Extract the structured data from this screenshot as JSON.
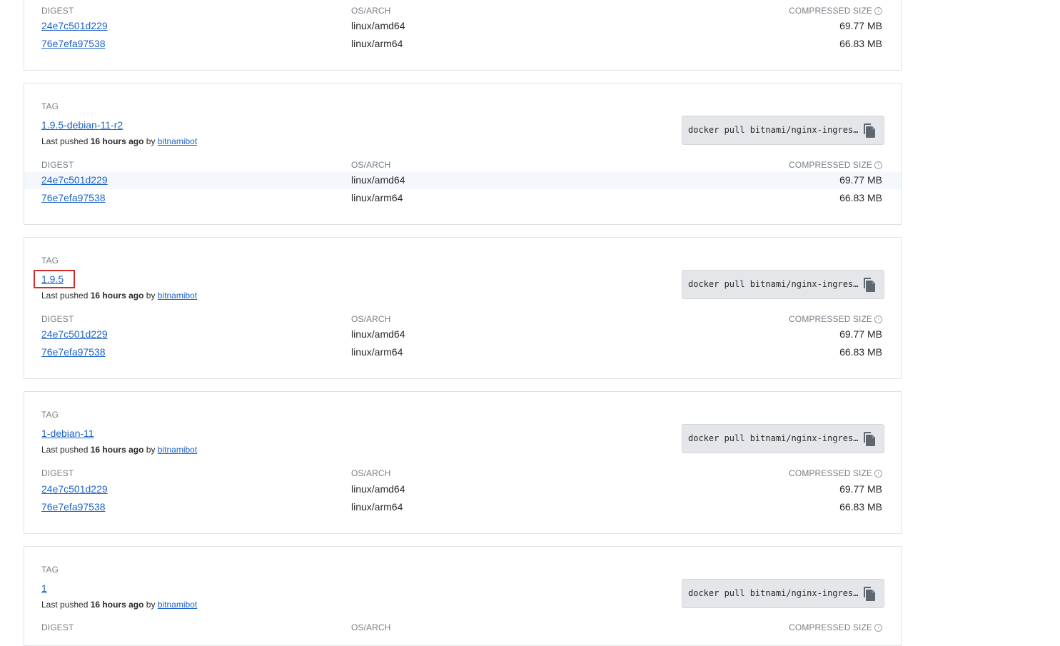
{
  "labels": {
    "tag": "TAG",
    "digest": "DIGEST",
    "os_arch": "OS/ARCH",
    "compressed_size": "COMPRESSED SIZE",
    "last_pushed": "Last pushed",
    "by": "by"
  },
  "pull_command": "docker pull bitnami/nginx-ingres…",
  "cards": [
    {
      "tag": null,
      "pushed_ago": null,
      "pushed_by": null,
      "rows": [
        {
          "digest": "24e7c501d229",
          "os_arch": "linux/amd64",
          "size": "69.77 MB"
        },
        {
          "digest": "76e7efa97538",
          "os_arch": "linux/arm64",
          "size": "66.83 MB"
        }
      ]
    },
    {
      "tag": "1.9.5-debian-11-r2",
      "pushed_ago": "16 hours ago",
      "pushed_by": "bitnamibot",
      "rows": [
        {
          "digest": "24e7c501d229",
          "os_arch": "linux/amd64",
          "size": "69.77 MB",
          "highlighted": true
        },
        {
          "digest": "76e7efa97538",
          "os_arch": "linux/arm64",
          "size": "66.83 MB"
        }
      ]
    },
    {
      "tag": "1.9.5",
      "pushed_ago": "16 hours ago",
      "pushed_by": "bitnamibot",
      "rows": [
        {
          "digest": "24e7c501d229",
          "os_arch": "linux/amd64",
          "size": "69.77 MB"
        },
        {
          "digest": "76e7efa97538",
          "os_arch": "linux/arm64",
          "size": "66.83 MB"
        }
      ]
    },
    {
      "tag": "1-debian-11",
      "pushed_ago": "16 hours ago",
      "pushed_by": "bitnamibot",
      "rows": [
        {
          "digest": "24e7c501d229",
          "os_arch": "linux/amd64",
          "size": "69.77 MB"
        },
        {
          "digest": "76e7efa97538",
          "os_arch": "linux/arm64",
          "size": "66.83 MB"
        }
      ]
    },
    {
      "tag": "1",
      "pushed_ago": "16 hours ago",
      "pushed_by": "bitnamibot",
      "rows": []
    }
  ],
  "colors": {
    "link": "#1d63c8",
    "highlight_border": "#d62b2b",
    "card_border": "#e1e2e6"
  },
  "icons": {
    "copy": "copy-icon",
    "info": "info-icon"
  }
}
